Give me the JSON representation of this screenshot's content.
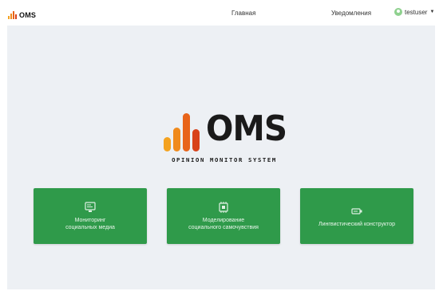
{
  "app": {
    "logo_text": "OMS",
    "tagline": "OPINION MONITOR SYSTEM"
  },
  "nav": {
    "home_label": "Главная",
    "notifications_label": "Уведомления",
    "username": "testuser"
  },
  "cards": [
    {
      "label": "Мониторинг\nсоциальных медиа",
      "icon": "monitor-icon"
    },
    {
      "label": "Моделирование\nсоциального самочувствия",
      "icon": "chip-icon"
    },
    {
      "label": "Лингвистический конструктор",
      "icon": "toggle-icon"
    }
  ],
  "colors": {
    "accent_green": "#2f9a4a",
    "logo_bar_1": "#f4a21f",
    "logo_bar_2": "#f08a1c",
    "logo_bar_3": "#e8641a",
    "logo_bar_4": "#d8421a",
    "page_background": "#edf0f4"
  }
}
